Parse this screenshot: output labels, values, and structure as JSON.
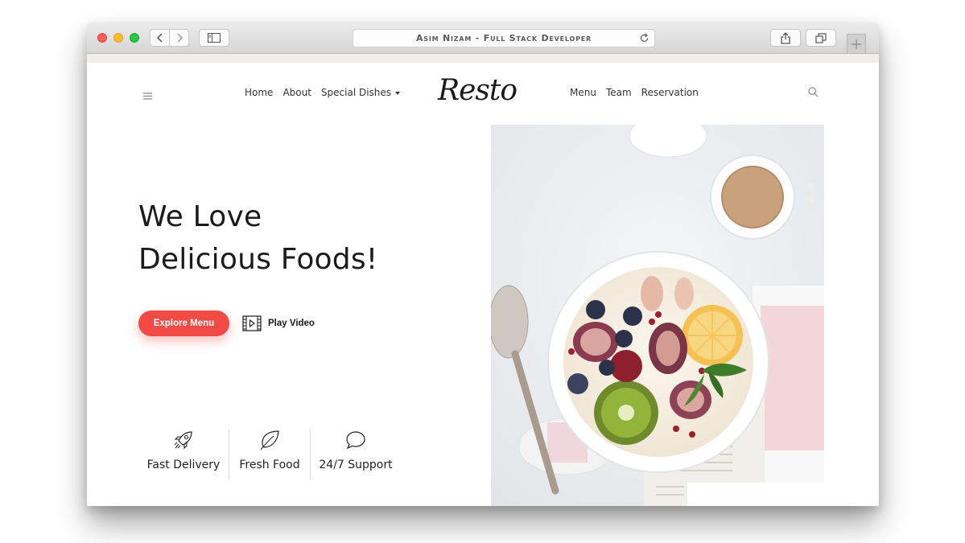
{
  "browser": {
    "address_title": "Asim Nizam - Full Stack Developer"
  },
  "site": {
    "logo": "Resto",
    "nav_left": [
      "Home",
      "About",
      "Special Dishes"
    ],
    "nav_right": [
      "Menu",
      "Team",
      "Reservation"
    ],
    "hero": {
      "title_line1": "We Love",
      "title_line2": "Delicious Foods!",
      "explore_button": "Explore Menu",
      "play_video": "Play Video"
    },
    "features": [
      {
        "label": "Fast Delivery",
        "icon": "rocket-icon"
      },
      {
        "label": "Fresh Food",
        "icon": "leaf-icon"
      },
      {
        "label": "24/7 Support",
        "icon": "chat-bubble-icon"
      }
    ],
    "colors": {
      "accent": "#f24a45",
      "text": "#1b1b1b"
    }
  }
}
